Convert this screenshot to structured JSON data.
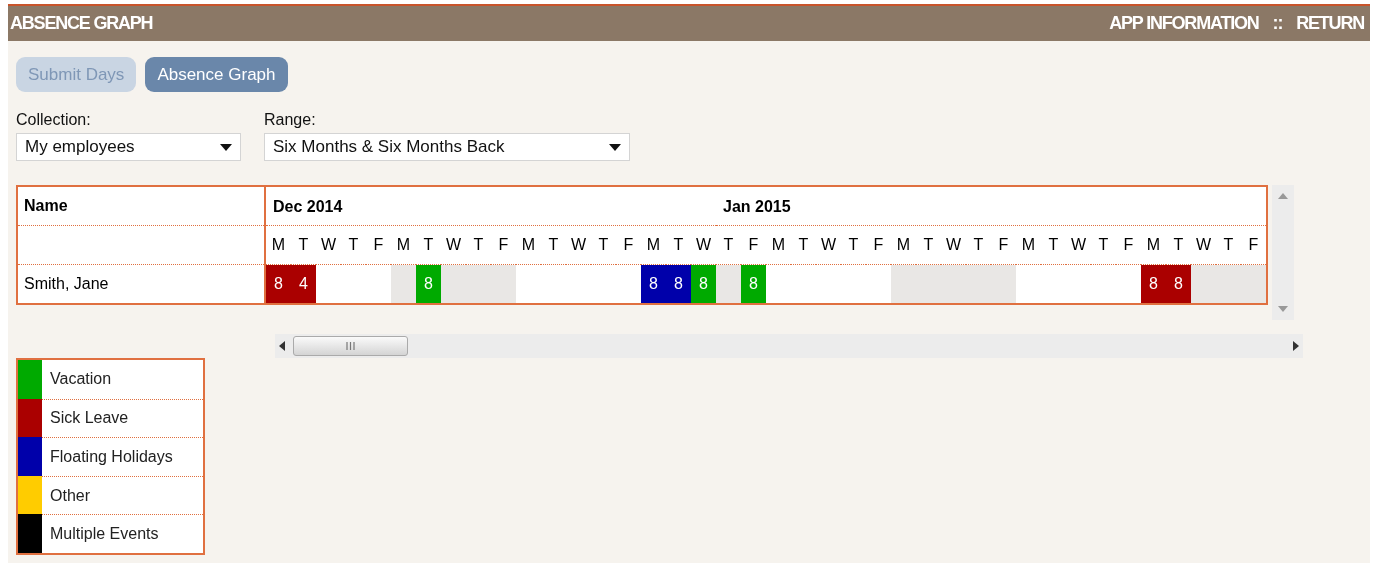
{
  "header": {
    "title": "ABSENCE GRAPH",
    "links": [
      "APP INFORMATION",
      "::",
      "RETURN"
    ]
  },
  "tabs": [
    {
      "label": "Submit Days",
      "selected": false
    },
    {
      "label": "Absence Graph",
      "selected": true
    }
  ],
  "filters": [
    {
      "label": "Collection:",
      "value": "My employees"
    },
    {
      "label": "Range:",
      "value": "Six Months & Six Months Back"
    }
  ],
  "grid": {
    "name_header": "Name",
    "weeks": [
      {
        "shaded": false,
        "days": [
          {
            "letter": "M",
            "month": "Dec 2014"
          },
          {
            "letter": "T"
          },
          {
            "letter": "W"
          },
          {
            "letter": "T"
          },
          {
            "letter": "F"
          }
        ]
      },
      {
        "shaded": true,
        "days": [
          {
            "letter": "M"
          },
          {
            "letter": "T"
          },
          {
            "letter": "W"
          },
          {
            "letter": "T"
          },
          {
            "letter": "F"
          }
        ]
      },
      {
        "shaded": false,
        "days": [
          {
            "letter": "M"
          },
          {
            "letter": "T"
          },
          {
            "letter": "W"
          },
          {
            "letter": "T"
          },
          {
            "letter": "F"
          }
        ]
      },
      {
        "shaded": true,
        "days": [
          {
            "letter": "M"
          },
          {
            "letter": "T"
          },
          {
            "letter": "W"
          },
          {
            "letter": "T",
            "month": "Jan 2015"
          },
          {
            "letter": "F"
          }
        ]
      },
      {
        "shaded": false,
        "days": [
          {
            "letter": "M"
          },
          {
            "letter": "T"
          },
          {
            "letter": "W"
          },
          {
            "letter": "T"
          },
          {
            "letter": "F"
          }
        ]
      },
      {
        "shaded": true,
        "days": [
          {
            "letter": "M"
          },
          {
            "letter": "T"
          },
          {
            "letter": "W"
          },
          {
            "letter": "T"
          },
          {
            "letter": "F"
          }
        ]
      },
      {
        "shaded": false,
        "days": [
          {
            "letter": "M"
          },
          {
            "letter": "T"
          },
          {
            "letter": "W"
          },
          {
            "letter": "T"
          },
          {
            "letter": "F"
          }
        ]
      },
      {
        "shaded": true,
        "days": [
          {
            "letter": "M"
          },
          {
            "letter": "T"
          },
          {
            "letter": "W"
          },
          {
            "letter": "T"
          },
          {
            "letter": "F"
          }
        ]
      }
    ],
    "rows": [
      {
        "name": "Smith, Jane",
        "days": [
          {
            "kind": "absence",
            "hours": "8",
            "color": "#aa0000"
          },
          {
            "kind": "absence",
            "hours": "4",
            "color": "#aa0000"
          },
          {
            "kind": "blank"
          },
          {
            "kind": "blank"
          },
          {
            "kind": "blank"
          },
          {
            "kind": "blank"
          },
          {
            "kind": "absence",
            "hours": "8",
            "color": "#00aa00"
          },
          {
            "kind": "blank"
          },
          {
            "kind": "blank"
          },
          {
            "kind": "blank"
          },
          {
            "kind": "blank"
          },
          {
            "kind": "blank"
          },
          {
            "kind": "blank"
          },
          {
            "kind": "blank"
          },
          {
            "kind": "blank"
          },
          {
            "kind": "absence",
            "hours": "8",
            "color": "#0000aa"
          },
          {
            "kind": "absence",
            "hours": "8",
            "color": "#0000aa"
          },
          {
            "kind": "absence",
            "hours": "8",
            "color": "#00aa00"
          },
          {
            "kind": "blank"
          },
          {
            "kind": "absence",
            "hours": "8",
            "color": "#00aa00"
          },
          {
            "kind": "blank"
          },
          {
            "kind": "blank"
          },
          {
            "kind": "blank"
          },
          {
            "kind": "blank"
          },
          {
            "kind": "blank"
          },
          {
            "kind": "blank"
          },
          {
            "kind": "blank"
          },
          {
            "kind": "blank"
          },
          {
            "kind": "blank"
          },
          {
            "kind": "blank"
          },
          {
            "kind": "blank"
          },
          {
            "kind": "blank"
          },
          {
            "kind": "blank"
          },
          {
            "kind": "blank"
          },
          {
            "kind": "blank"
          },
          {
            "kind": "absence",
            "hours": "8",
            "color": "#aa0000"
          },
          {
            "kind": "absence",
            "hours": "8",
            "color": "#aa0000"
          },
          {
            "kind": "blank"
          },
          {
            "kind": "blank"
          },
          {
            "kind": "blank"
          }
        ]
      }
    ]
  },
  "legend": [
    {
      "label": "Vacation",
      "color": "#00aa00"
    },
    {
      "label": "Sick Leave",
      "color": "#aa0000"
    },
    {
      "label": "Floating Holidays",
      "color": "#0000aa"
    },
    {
      "label": "Other",
      "color": "#ffcc00"
    },
    {
      "label": "Multiple Events",
      "color": "#000000"
    }
  ]
}
